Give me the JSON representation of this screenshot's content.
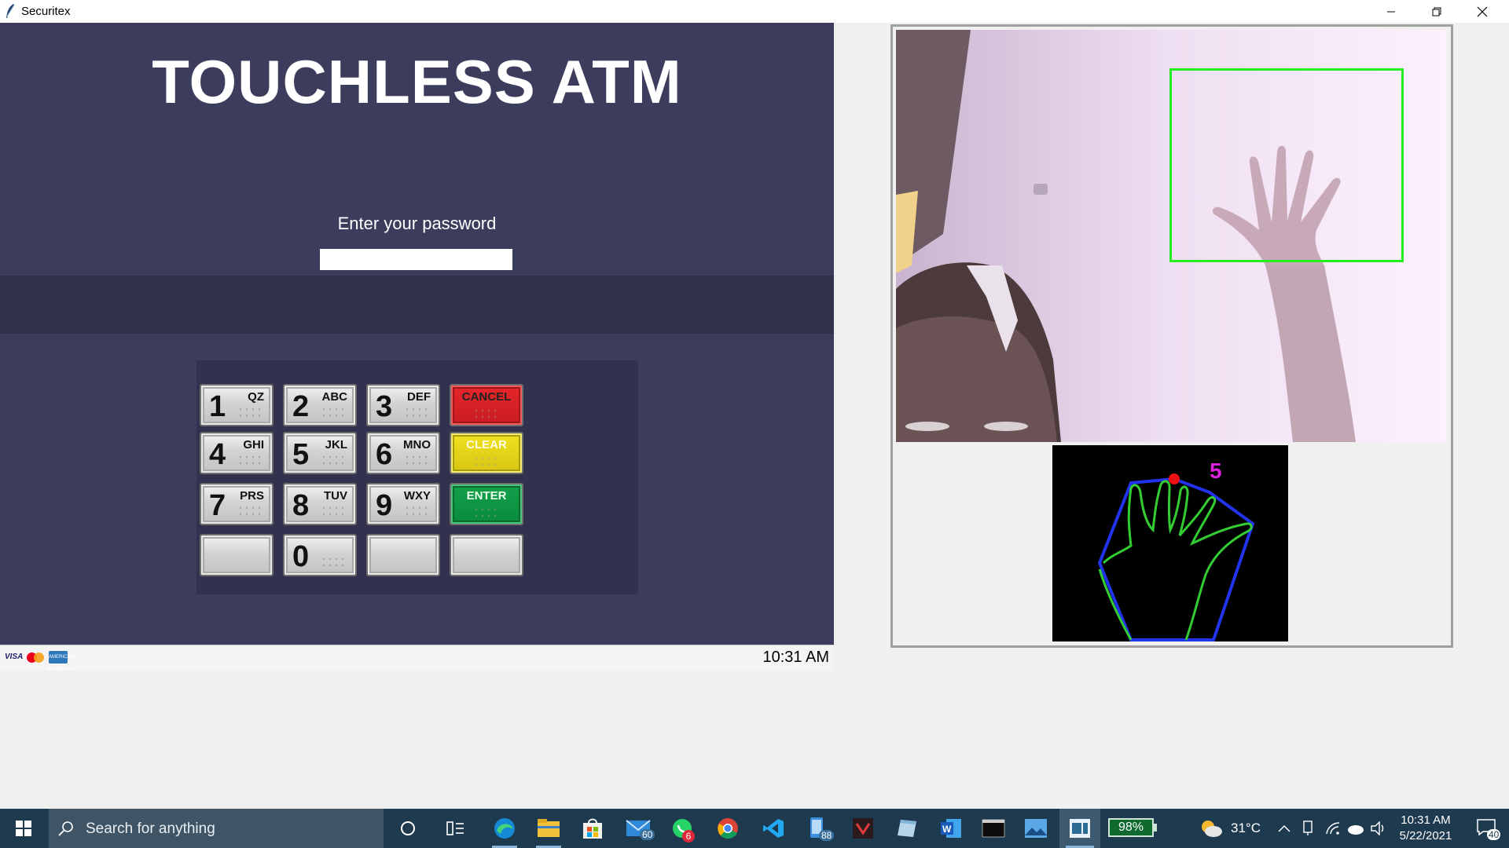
{
  "window": {
    "title": "Securitex"
  },
  "atm": {
    "title": "TOUCHLESS ATM",
    "password_label": "Enter your password",
    "password_value": "",
    "clock": "10:31 AM",
    "cards": {
      "visa": "VISA",
      "amex": "AMERICAN EXPRESS"
    },
    "keys": [
      {
        "num": "1",
        "letters": "QZ"
      },
      {
        "num": "2",
        "letters": "ABC"
      },
      {
        "num": "3",
        "letters": "DEF"
      },
      {
        "num": "4",
        "letters": "GHI"
      },
      {
        "num": "5",
        "letters": "JKL"
      },
      {
        "num": "6",
        "letters": "MNO"
      },
      {
        "num": "7",
        "letters": "PRS"
      },
      {
        "num": "8",
        "letters": "TUV"
      },
      {
        "num": "9",
        "letters": "WXY"
      },
      {
        "num": "0",
        "letters": ""
      }
    ],
    "functions": {
      "cancel": "CANCEL",
      "clear": "CLEAR",
      "enter": "ENTER"
    }
  },
  "camera": {
    "finger_count": "5"
  },
  "taskbar": {
    "search_placeholder": "Search for anything",
    "mail_badge": "60",
    "whatsapp_badge": "6",
    "app_badge": "88",
    "battery": "98%",
    "temperature": "31°C",
    "time": "10:31 AM",
    "date": "5/22/2021",
    "notifications": "40"
  },
  "colors": {
    "atm_bg": "#3c3c5c",
    "detect_box": "#22ee22",
    "contour": "#33cc33",
    "hull": "#2233ee",
    "fingertip": "#ee1111",
    "count_text": "#dd22dd",
    "taskbar_bg": "#1e3a4f"
  }
}
